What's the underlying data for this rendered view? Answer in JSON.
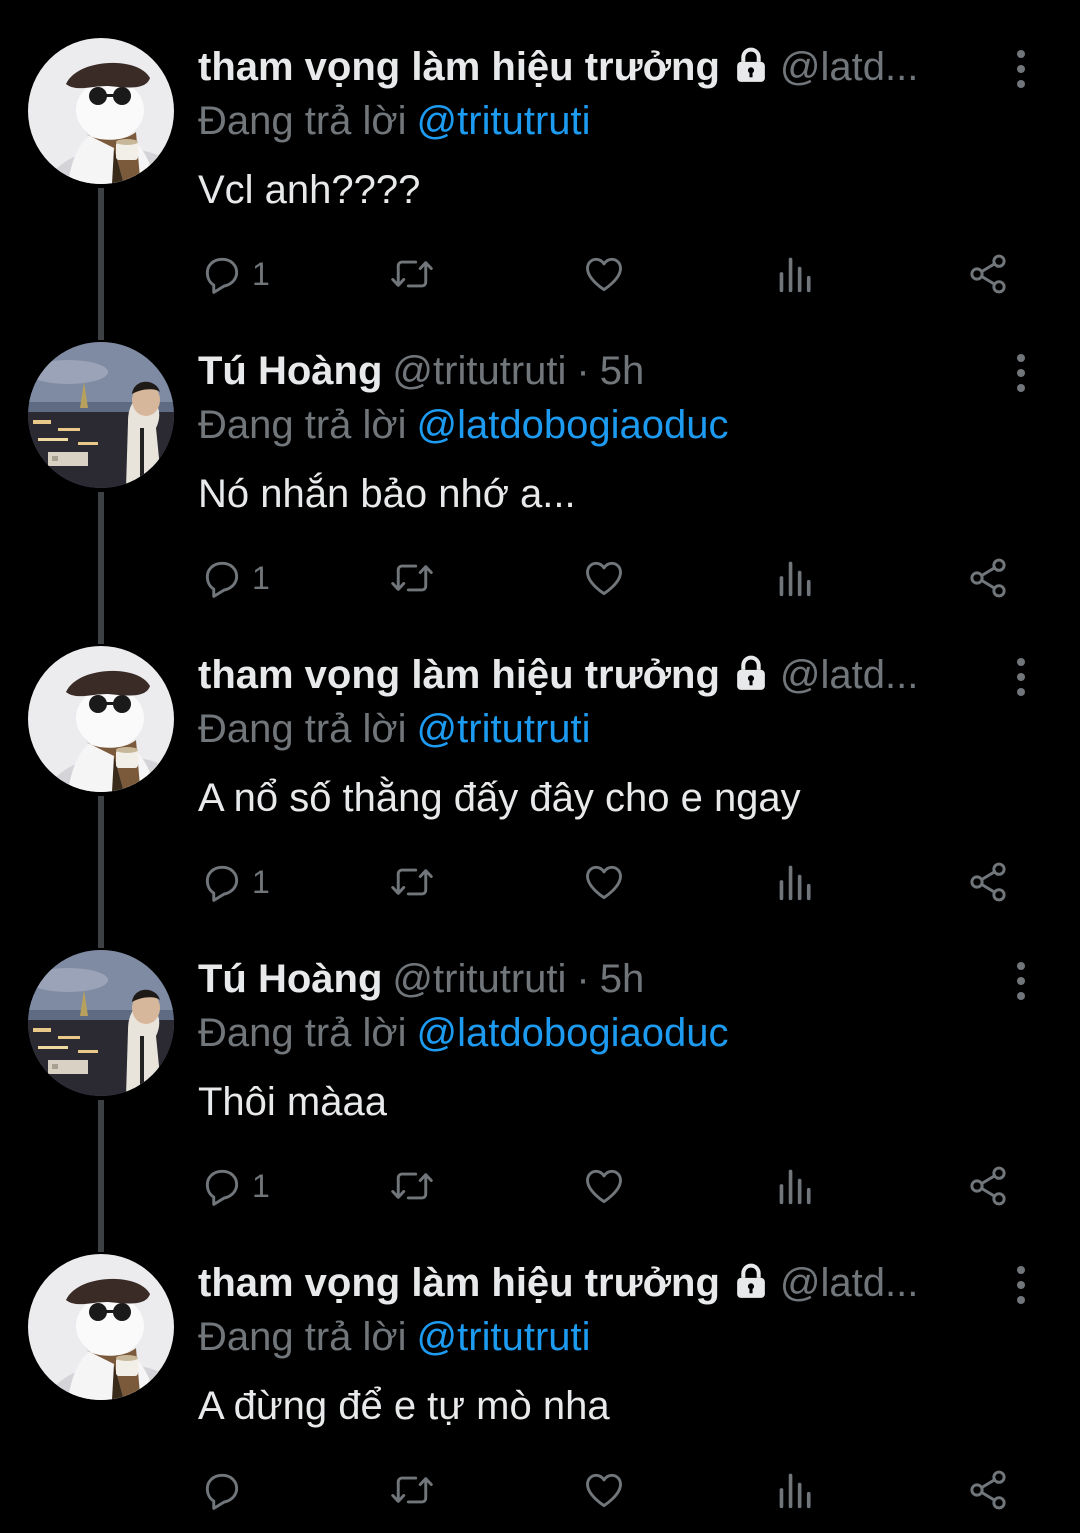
{
  "colors": {
    "background": "#000000",
    "primary_text": "#e7e9ea",
    "secondary_text": "#71767b",
    "link": "#1d9bf0",
    "thread_line": "#3e4144"
  },
  "tweets": [
    {
      "name": "tham vọng làm hiệu trưởng",
      "locked": true,
      "handle": "@latd...",
      "dot": "",
      "time": "",
      "replying_prefix": "Đang trả lời",
      "replying_to": "@tritutruti",
      "text": "Vcl anh????",
      "reply_count": "1",
      "avatar": "cat-avatar"
    },
    {
      "name": "Tú Hoàng",
      "locked": false,
      "handle": "@tritutruti",
      "dot": "·",
      "time": "5h",
      "replying_prefix": "Đang trả lời",
      "replying_to": "@latdobogiaoduc",
      "text": "Nó nhắn bảo nhớ a...",
      "reply_count": "1",
      "avatar": "night-city-avatar"
    },
    {
      "name": "tham vọng làm hiệu trưởng",
      "locked": true,
      "handle": "@latd...",
      "dot": "",
      "time": "",
      "replying_prefix": "Đang trả lời",
      "replying_to": "@tritutruti",
      "text": "A nổ số thằng đấy đây cho e ngay",
      "reply_count": "1",
      "avatar": "cat-avatar"
    },
    {
      "name": "Tú Hoàng",
      "locked": false,
      "handle": "@tritutruti",
      "dot": "·",
      "time": "5h",
      "replying_prefix": "Đang trả lời",
      "replying_to": "@latdobogiaoduc",
      "text": "Thôi màaa",
      "reply_count": "1",
      "avatar": "night-city-avatar"
    },
    {
      "name": "tham vọng làm hiệu trưởng",
      "locked": true,
      "handle": "@latd...",
      "dot": "",
      "time": "",
      "replying_prefix": "Đang trả lời",
      "replying_to": "@tritutruti",
      "text": "A đừng để e tự mò nha",
      "reply_count": "",
      "avatar": "cat-avatar"
    }
  ],
  "action_icons": [
    "reply-icon",
    "retweet-icon",
    "like-icon",
    "views-icon",
    "share-icon"
  ]
}
